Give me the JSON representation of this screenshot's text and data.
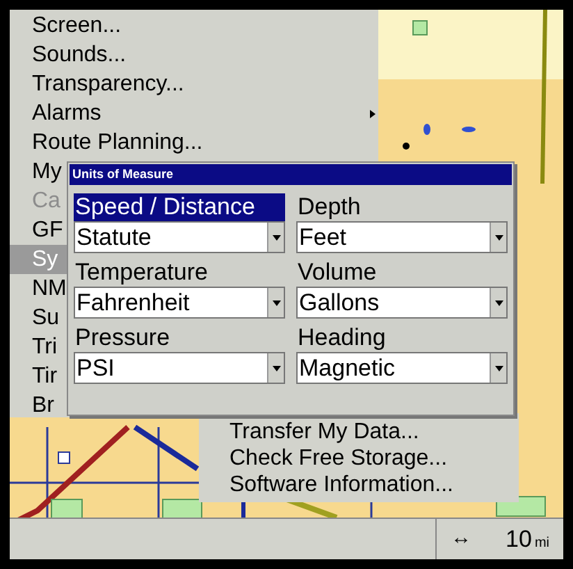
{
  "menu": {
    "items": [
      {
        "label": "Screen...",
        "selected": false,
        "disabled": false,
        "submenu": false
      },
      {
        "label": "Sounds...",
        "selected": false,
        "disabled": false,
        "submenu": false
      },
      {
        "label": "Transparency...",
        "selected": false,
        "disabled": false,
        "submenu": false
      },
      {
        "label": "Alarms",
        "selected": false,
        "disabled": false,
        "submenu": true
      },
      {
        "label": "Route Planning...",
        "selected": false,
        "disabled": false,
        "submenu": false
      },
      {
        "label": "My",
        "selected": false,
        "disabled": false
      },
      {
        "label": "Ca",
        "selected": false,
        "disabled": true
      },
      {
        "label": "GF",
        "selected": false,
        "disabled": false
      },
      {
        "label": "Sy",
        "selected": true,
        "disabled": false
      },
      {
        "label": "NM",
        "selected": false,
        "disabled": false
      },
      {
        "label": "Su",
        "selected": false,
        "disabled": false
      },
      {
        "label": "Tri",
        "selected": false,
        "disabled": false
      },
      {
        "label": "Tir",
        "selected": false,
        "disabled": false
      },
      {
        "label": "Br",
        "selected": false,
        "disabled": false
      }
    ]
  },
  "dialog": {
    "title": "Units of Measure",
    "fields": [
      {
        "label": "Speed / Distance",
        "value": "Statute",
        "selected": true
      },
      {
        "label": "Depth",
        "value": "Feet",
        "selected": false
      },
      {
        "label": "Temperature",
        "value": "Fahrenheit",
        "selected": false
      },
      {
        "label": "Volume",
        "value": "Gallons",
        "selected": false
      },
      {
        "label": "Pressure",
        "value": "PSI",
        "selected": false
      },
      {
        "label": "Heading",
        "value": "Magnetic",
        "selected": false
      }
    ]
  },
  "submenu": {
    "items": [
      "Transfer My Data...",
      "Check Free Storage...",
      "Software Information..."
    ]
  },
  "status_bar": {
    "scale_symbol": "↔",
    "scale_value": "10",
    "scale_unit": "mi"
  }
}
